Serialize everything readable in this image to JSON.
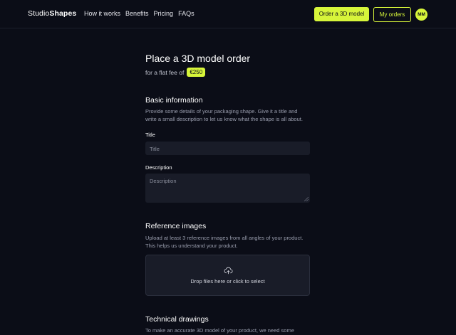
{
  "nav": {
    "logo_light": "Studio",
    "logo_bold": "Shapes",
    "links": [
      "How it works",
      "Benefits",
      "Pricing",
      "FAQs"
    ],
    "order_button": "Order a 3D model",
    "my_orders_button": "My orders",
    "avatar_initials": "MM"
  },
  "page": {
    "title": "Place a 3D model order",
    "fee_prefix": "for a flat fee of",
    "fee_value": "€250"
  },
  "basic_info": {
    "heading": "Basic information",
    "description": "Provide some details of your packaging shape. Give it a title and write a small description to let us know what the shape is all about.",
    "title_label": "Title",
    "title_placeholder": "Title",
    "description_label": "Description",
    "description_placeholder": "Description"
  },
  "reference_images": {
    "heading": "Reference images",
    "description": "Upload at least 3 reference images from all angles of your product. This helps us understand your product.",
    "dropzone_text": "Drop files here or click to select"
  },
  "technical_drawings": {
    "heading": "Technical drawings",
    "description": "To make an accurate 3D model of your product, we need some"
  },
  "colors": {
    "background": "#0b0d17",
    "accent": "#d7f53a",
    "field": "#191c28"
  }
}
